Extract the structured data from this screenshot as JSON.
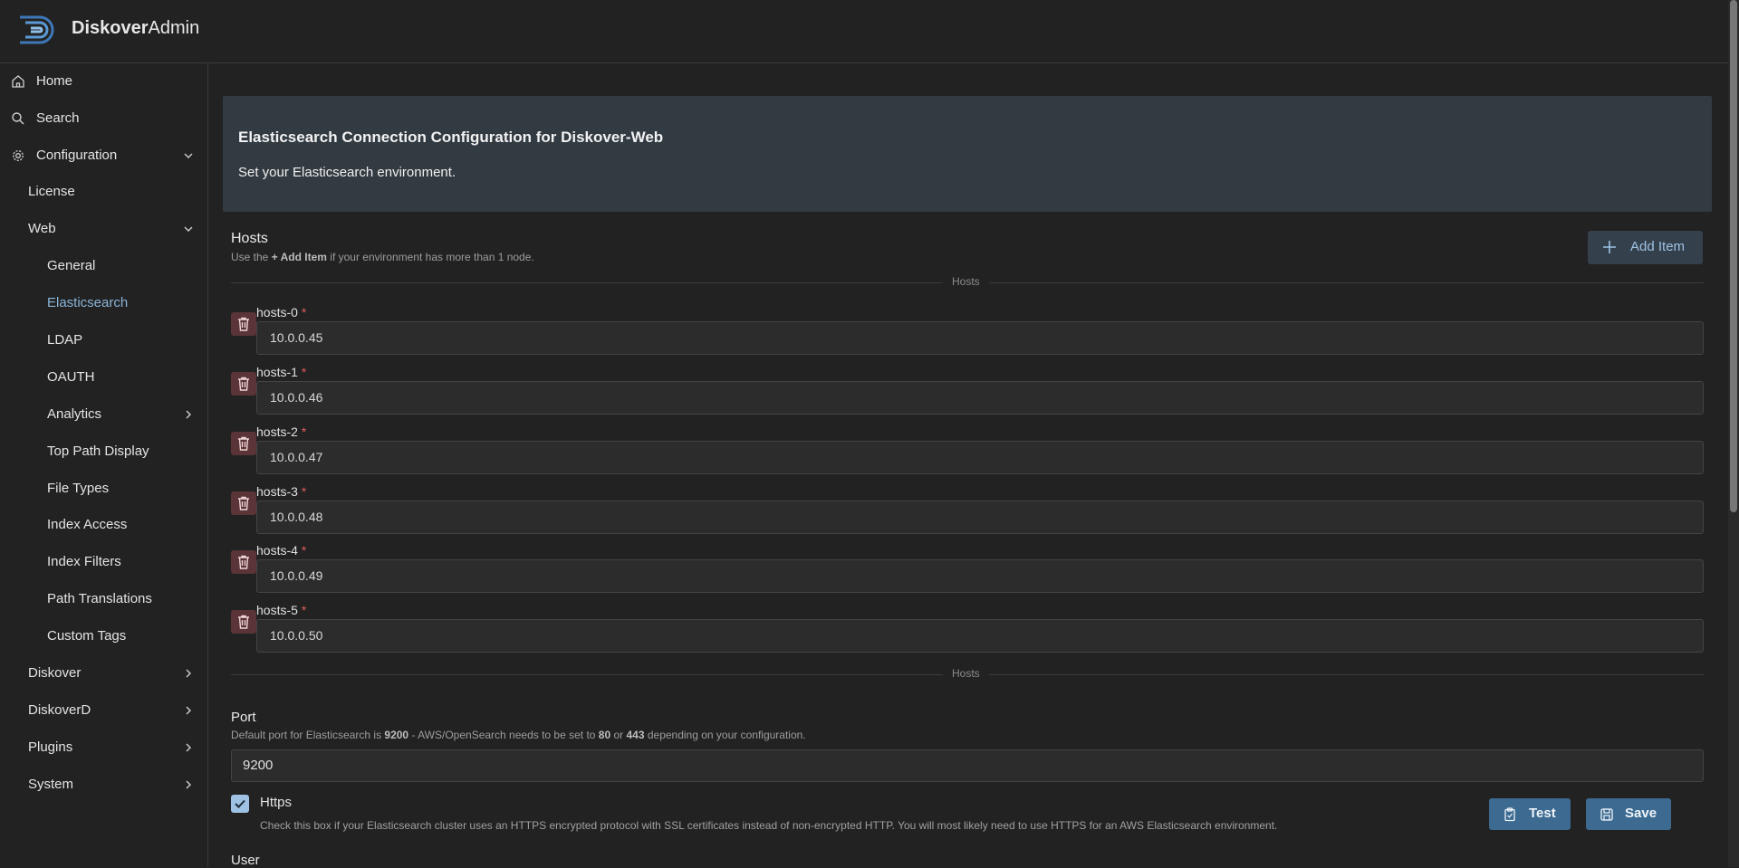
{
  "app": {
    "brand_bold": "Diskover",
    "brand_light": "Admin"
  },
  "sidebar": {
    "items": [
      {
        "label": "Home",
        "icon": "home-icon"
      },
      {
        "label": "Search",
        "icon": "search-icon"
      },
      {
        "label": "Configuration",
        "icon": "gear-icon"
      },
      {
        "label": "License"
      },
      {
        "label": "Web"
      },
      {
        "label": "General"
      },
      {
        "label": "Elasticsearch",
        "active": true
      },
      {
        "label": "LDAP"
      },
      {
        "label": "OAUTH"
      },
      {
        "label": "Analytics"
      },
      {
        "label": "Top Path Display"
      },
      {
        "label": "File Types"
      },
      {
        "label": "Index Access"
      },
      {
        "label": "Index Filters"
      },
      {
        "label": "Path Translations"
      },
      {
        "label": "Custom Tags"
      },
      {
        "label": "Diskover"
      },
      {
        "label": "DiskoverD"
      },
      {
        "label": "Plugins"
      },
      {
        "label": "System"
      }
    ]
  },
  "banner": {
    "title": "Elasticsearch Connection Configuration for Diskover-Web",
    "subtitle": "Set your Elasticsearch environment."
  },
  "hosts": {
    "title": "Hosts",
    "help_prefix": "Use the ",
    "help_bold": "+ Add Item",
    "help_suffix": " if your environment has more than 1 node.",
    "add_label": "Add Item",
    "divider_label": "Hosts",
    "required_mark": "*",
    "rows": [
      {
        "label": "hosts-0",
        "value": "10.0.0.45"
      },
      {
        "label": "hosts-1",
        "value": "10.0.0.46"
      },
      {
        "label": "hosts-2",
        "value": "10.0.0.47"
      },
      {
        "label": "hosts-3",
        "value": "10.0.0.48"
      },
      {
        "label": "hosts-4",
        "value": "10.0.0.49"
      },
      {
        "label": "hosts-5",
        "value": "10.0.0.50"
      }
    ]
  },
  "port": {
    "title": "Port",
    "help_a": "Default port for Elasticsearch is ",
    "help_b": "9200",
    "help_c": " - AWS/OpenSearch needs to be set to ",
    "help_d": "80",
    "help_e": " or ",
    "help_f": "443",
    "help_g": " depending on your configuration.",
    "value": "9200"
  },
  "https": {
    "label": "Https",
    "checked": true,
    "help": "Check this box if your Elasticsearch cluster uses an HTTPS encrypted protocol with SSL certificates instead of non-encrypted HTTP. You will most likely need to use HTTPS for an AWS Elasticsearch environment."
  },
  "actions": {
    "test_label": "Test",
    "save_label": "Save"
  },
  "user": {
    "label": "User"
  },
  "colors": {
    "accent": "#9fc2e4",
    "button": "#3c6a90",
    "danger": "#e05a5a",
    "banner": "#323a42"
  }
}
